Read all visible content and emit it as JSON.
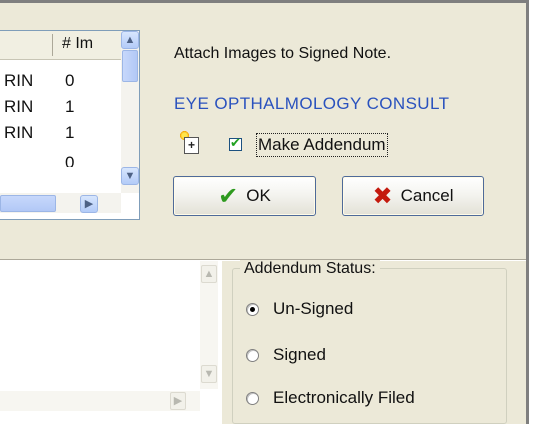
{
  "header": {
    "attach_label": "Attach Images to Signed Note.",
    "note_title": "EYE OPTHALMOLOGY CONSULT"
  },
  "addendum_checkbox": {
    "label": "Make Addendum",
    "checked": true
  },
  "buttons": {
    "ok_label": "OK",
    "cancel_label": "Cancel"
  },
  "image_table": {
    "column_header": "# Im",
    "rows": [
      {
        "title": "RIN",
        "count": "0"
      },
      {
        "title": "RIN",
        "count": "1"
      },
      {
        "title": "RIN",
        "count": "1"
      },
      {
        "title": "",
        "count": "0"
      }
    ]
  },
  "addendum_status": {
    "legend": "Addendum Status:",
    "options": [
      {
        "label": "Un-Signed",
        "selected": true
      },
      {
        "label": "Signed",
        "selected": false
      },
      {
        "label": "Electronically Filed",
        "selected": false
      }
    ]
  },
  "colors": {
    "dialog_bg": "#ece9d8",
    "title_link": "#2a52be",
    "ok_check": "#2e9a1f",
    "cancel_x": "#c41a0e",
    "table_header_bg": "#f1efe2"
  }
}
